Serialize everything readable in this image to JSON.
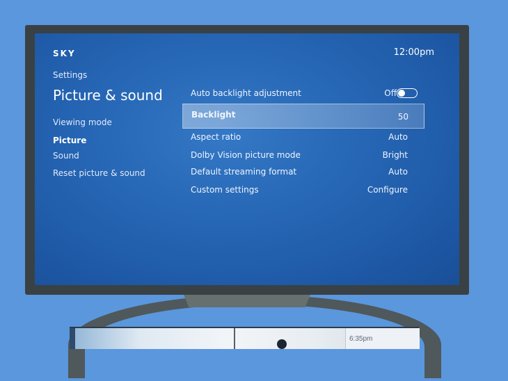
{
  "header": {
    "logo": "SKY",
    "clock": "12:00pm"
  },
  "breadcrumb": "Settings",
  "page_title": "Picture & sound",
  "nav": {
    "items": [
      {
        "label": "Viewing mode",
        "active": false
      },
      {
        "label": "Picture",
        "active": true
      },
      {
        "label": "Sound",
        "active": false
      },
      {
        "label": "Reset picture & sound",
        "active": false
      }
    ]
  },
  "settings": {
    "rows": [
      {
        "label": "Auto backlight adjustment",
        "value": "Off",
        "control": "toggle",
        "toggle_on": false
      },
      {
        "label": "Backlight",
        "value": "50",
        "selected": true
      },
      {
        "label": "Aspect ratio",
        "value": "Auto"
      },
      {
        "label": "Dolby Vision picture mode",
        "value": "Bright"
      },
      {
        "label": "Default streaming format",
        "value": "Auto"
      },
      {
        "label": "Custom settings",
        "value": "Configure"
      }
    ]
  },
  "photo_strip": {
    "time": "6:35pm"
  },
  "colors": {
    "background": "#5a97dd",
    "tv_frame": "#3a4144",
    "screen": "#2565b3"
  }
}
